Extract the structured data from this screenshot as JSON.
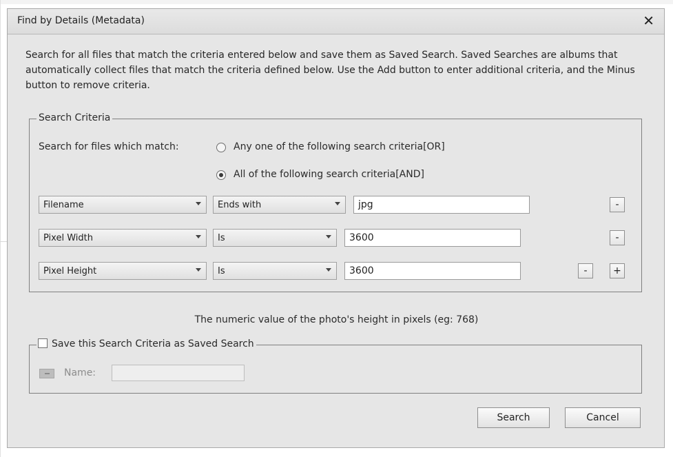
{
  "dialog": {
    "title": "Find by Details (Metadata)",
    "close_symbol": "✕",
    "description": "Search for all files that match the criteria entered below and save them as Saved Search. Saved Searches are albums that automatically collect files that match the criteria defined below. Use the Add button to enter additional criteria, and the Minus button to remove criteria."
  },
  "search_criteria": {
    "legend": "Search Criteria",
    "match_label": "Search for files which match:",
    "option_or": "Any one of the following search criteria[OR]",
    "option_and": "All of the following search criteria[AND]",
    "selected_option": "and",
    "rows": [
      {
        "field": "Filename",
        "operator": "Ends with",
        "value": "jpg",
        "remove": "-"
      },
      {
        "field": "Pixel Width",
        "operator": "Is",
        "value": "3600",
        "remove": "-"
      },
      {
        "field": "Pixel Height",
        "operator": "Is",
        "value": "3600",
        "remove": "-",
        "add": "+"
      }
    ]
  },
  "hint": "The numeric value of the photo's height in pixels (eg: 768)",
  "saved_search": {
    "legend": "Save this Search Criteria as Saved Search",
    "checked": false,
    "name_label": "Name:",
    "name_value": ""
  },
  "buttons": {
    "search": "Search",
    "cancel": "Cancel"
  }
}
